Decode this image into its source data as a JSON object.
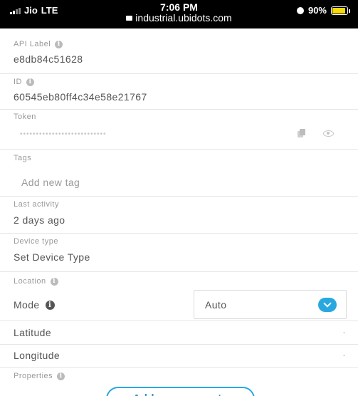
{
  "status_bar": {
    "carrier": "Jio",
    "network": "LTE",
    "time": "7:06 PM",
    "url": "industrial.ubidots.com",
    "battery": "90%",
    "battery_level": 0.9,
    "battery_color": "#f5d90f"
  },
  "fields": {
    "api_label": {
      "label": "API Label",
      "value": "e8db84c51628",
      "icon": "info-icon"
    },
    "id": {
      "label": "ID",
      "value": "60545eb80ff4c34e58e21767",
      "icon": "info-icon"
    },
    "token": {
      "label": "Token",
      "masked_value": "•••••••••••••••••••••••••••",
      "copy_icon": "copy-icon",
      "show_icon": "eye-icon"
    },
    "tags": {
      "label": "Tags",
      "placeholder": "Add new tag"
    },
    "last_activity": {
      "label": "Last activity",
      "value": "2 days ago"
    },
    "device_type": {
      "label": "Device type",
      "value": "Set Device Type"
    },
    "location": {
      "label": "Location",
      "icon": "info-icon"
    },
    "mode": {
      "label": "Mode",
      "value": "Auto",
      "icon": "info-icon"
    },
    "latitude": {
      "label": "Latitude",
      "value": "-"
    },
    "longitude": {
      "label": "Longitude",
      "value": "-"
    },
    "properties": {
      "label": "Properties",
      "icon": "info-icon"
    }
  },
  "actions": {
    "add_property": "Add new property"
  },
  "colors": {
    "accent": "#29a8e0",
    "label": "#999999",
    "text": "#555555"
  }
}
